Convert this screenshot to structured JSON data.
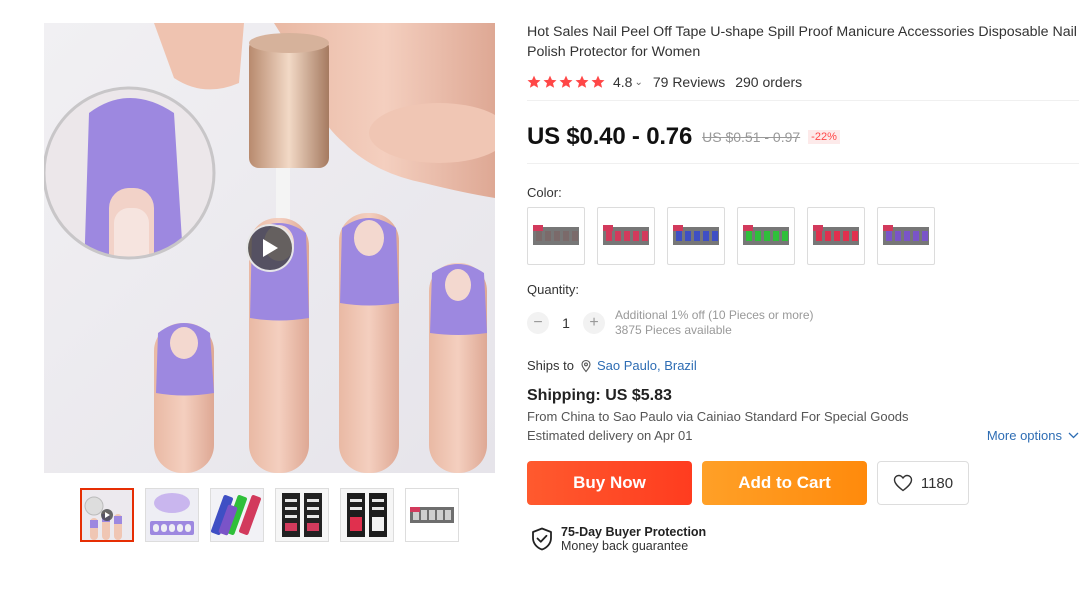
{
  "product": {
    "title": "Hot Sales Nail Peel Off Tape U-shape Spill Proof Manicure Accessories Disposable Nail Polish Protector for Women",
    "rating": 4.8,
    "rating_text": "4.8",
    "reviews": "79 Reviews",
    "orders": "290 orders",
    "price_current": "US $0.40 - 0.76",
    "price_original": "US $0.51 - 0.97",
    "discount": "-22%"
  },
  "colors": {
    "label": "Color:",
    "options": [
      {
        "name": "variant-1",
        "accent": "#7b6a6a"
      },
      {
        "name": "variant-2",
        "accent": "#d23a5c"
      },
      {
        "name": "variant-3",
        "accent": "#3f4fc4"
      },
      {
        "name": "variant-4",
        "accent": "#2fbf3a"
      },
      {
        "name": "variant-5",
        "accent": "#e0304e"
      },
      {
        "name": "variant-6",
        "accent": "#7a54c8"
      }
    ]
  },
  "quantity": {
    "label": "Quantity:",
    "value": "1",
    "minus": "−",
    "plus": "+",
    "discount_note": "Additional 1% off (10 Pieces or more)",
    "available": "3875 Pieces available"
  },
  "shipping": {
    "ships_to_label": "Ships to",
    "ships_to_location": "Sao Paulo, Brazil",
    "cost": "Shipping: US $5.83",
    "route": "From China to Sao Paulo via Cainiao Standard For Special Goods",
    "delivery": "Estimated delivery on Apr 01",
    "more_options": "More options"
  },
  "actions": {
    "buy_now": "Buy Now",
    "add_to_cart": "Add to Cart",
    "wishlist_count": "1180"
  },
  "protection": {
    "title": "75-Day Buyer Protection",
    "subtitle": "Money back guarantee"
  },
  "icons": {
    "star": "star-icon",
    "play": "play-icon",
    "location": "location-pin-icon",
    "heart": "heart-icon",
    "shield": "shield-check-icon",
    "chevron": "chevron-down-icon"
  },
  "colors_theme": {
    "star": "#ff4747",
    "link": "#2e6db4",
    "buy_now": "#ff4a24",
    "add_to_cart": "#ff9a1a",
    "nail_purple": "#9d88e0"
  }
}
